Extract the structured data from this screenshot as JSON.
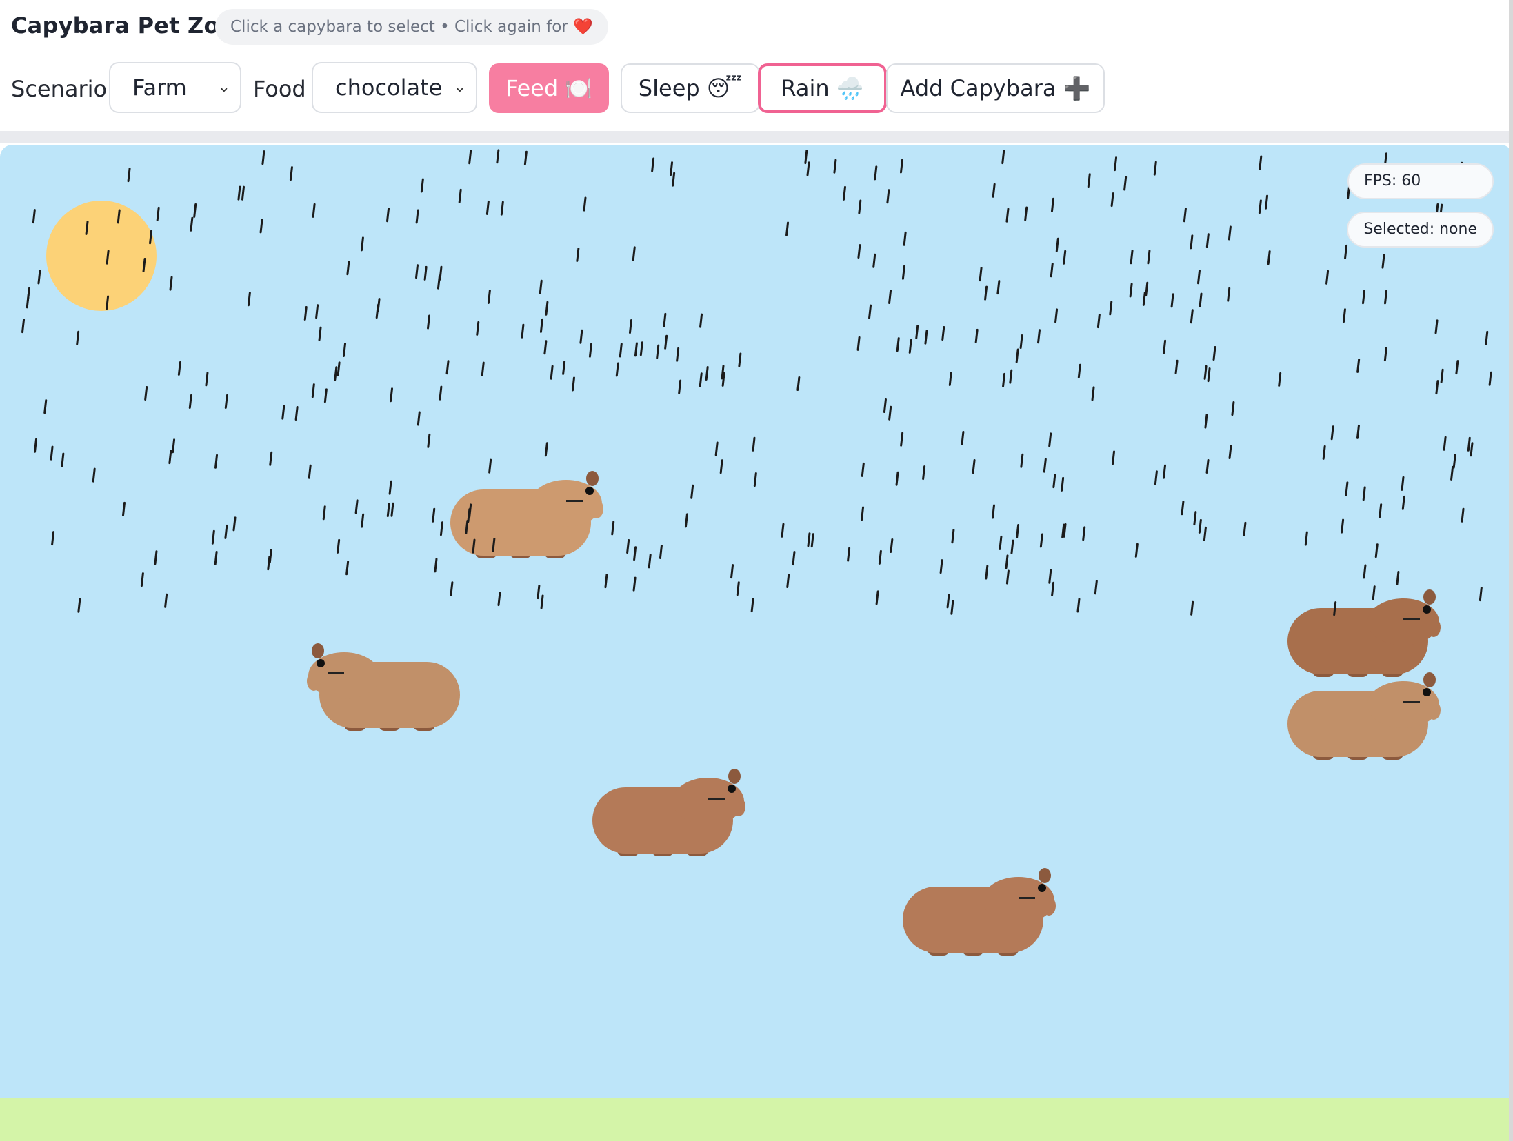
{
  "app": {
    "title": "Capybara Pet Zoo",
    "hint_text": "Click a capybara to select • Click again for",
    "hint_icon": "❤️"
  },
  "controls": {
    "scenario_label": "Scenario",
    "scenario_value": "Farm",
    "food_label": "Food",
    "food_value": "chocolate",
    "feed_button": "Feed 🍽️",
    "sleep_button": "Sleep 😴",
    "rain_button": "Rain 🌧️",
    "add_button": "Add Capybara ➕"
  },
  "hud": {
    "fps": "FPS: 60",
    "selected": "Selected: none"
  },
  "scene": {
    "scenario": "Farm",
    "raining": true,
    "colors": {
      "sky": "#bde5f9",
      "ground": "#d4f4a8",
      "sun": "#fcd277",
      "rain": "#1b1b1b",
      "capy_light": "#cd9a6f",
      "capy_mid": "#c19069",
      "capy_dark": "#b47a58",
      "capy_darker": "#a86f4c",
      "capy_legs": "#8c5a3e",
      "capy_ear": "#8c5a3e",
      "feed_accent": "#f77ea1",
      "rain_accent": "#f06292"
    },
    "capybaras": [
      {
        "id": 1,
        "facing": "right",
        "tone": "capy_light"
      },
      {
        "id": 2,
        "facing": "left",
        "tone": "capy_mid"
      },
      {
        "id": 3,
        "facing": "right",
        "tone": "capy_dark"
      },
      {
        "id": 4,
        "facing": "right",
        "tone": "capy_dark"
      },
      {
        "id": 5,
        "facing": "right",
        "tone": "capy_darker"
      },
      {
        "id": 6,
        "facing": "right",
        "tone": "capy_mid"
      }
    ]
  }
}
